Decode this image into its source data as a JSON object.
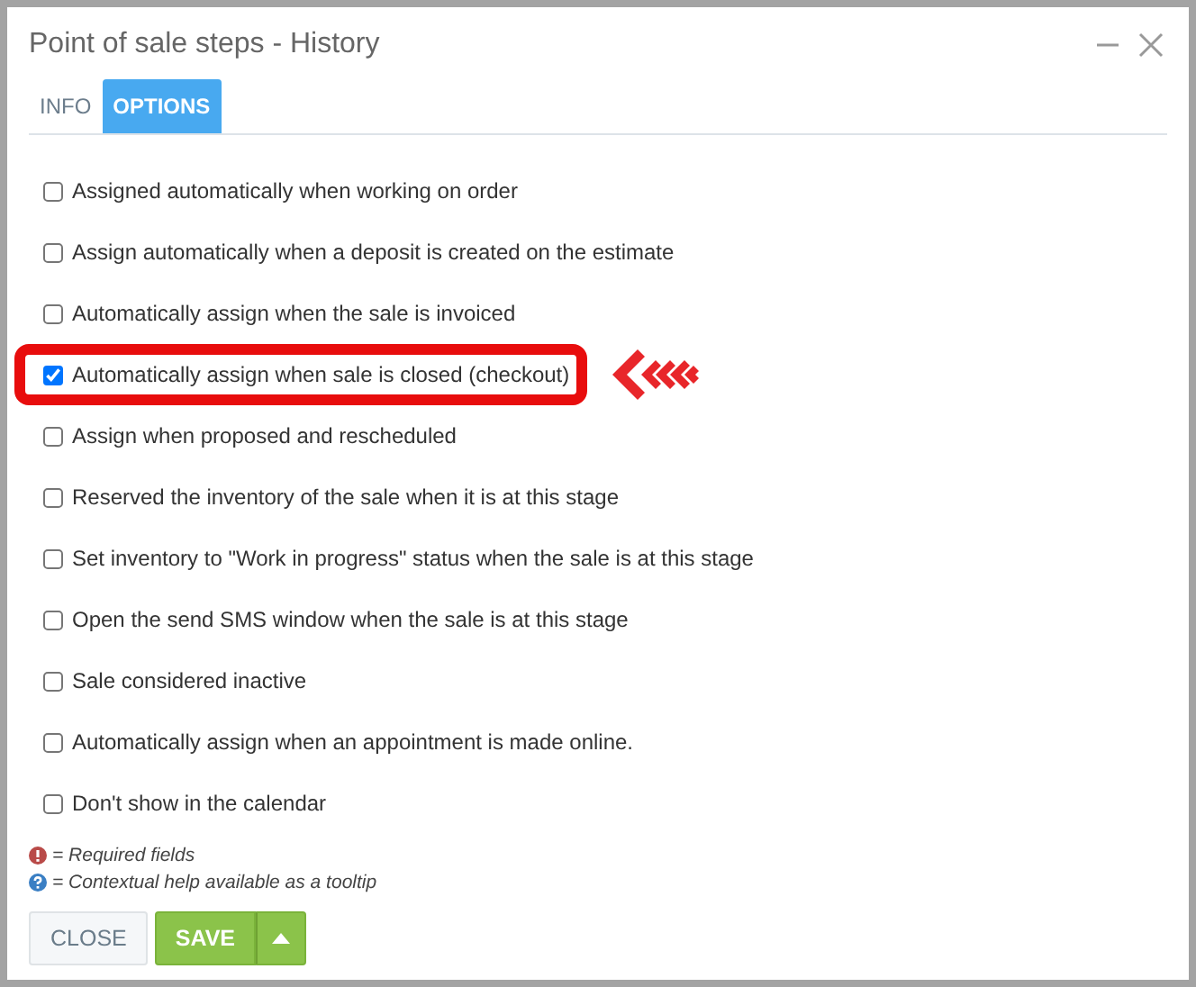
{
  "window": {
    "title": "Point of sale steps - History"
  },
  "tabs": [
    {
      "label": "INFO",
      "selected": false
    },
    {
      "label": "OPTIONS",
      "selected": true
    }
  ],
  "options": [
    {
      "label": "Assigned automatically when working on order",
      "checked": false,
      "highlighted": false
    },
    {
      "label": "Assign automatically when a deposit is created on the estimate",
      "checked": false,
      "highlighted": false
    },
    {
      "label": "Automatically assign when the sale is invoiced",
      "checked": false,
      "highlighted": false
    },
    {
      "label": "Automatically assign when sale is closed (checkout)",
      "checked": true,
      "highlighted": true
    },
    {
      "label": "Assign when proposed and rescheduled",
      "checked": false,
      "highlighted": false
    },
    {
      "label": "Reserved the inventory of the sale when it is at this stage",
      "checked": false,
      "highlighted": false
    },
    {
      "label": "Set inventory to \"Work in progress\" status when the sale is at this stage",
      "checked": false,
      "highlighted": false
    },
    {
      "label": "Open the send SMS window when the sale is at this stage",
      "checked": false,
      "highlighted": false
    },
    {
      "label": "Sale considered inactive",
      "checked": false,
      "highlighted": false
    },
    {
      "label": "Automatically assign when an appointment is made online.",
      "checked": false,
      "highlighted": false
    },
    {
      "label": "Don't show in the calendar",
      "checked": false,
      "highlighted": false
    }
  ],
  "legend": [
    {
      "kind": "required",
      "text": "= Required fields"
    },
    {
      "kind": "help",
      "text": "= Contextual help available as a tooltip"
    }
  ],
  "buttons": {
    "close": "CLOSE",
    "save": "SAVE"
  }
}
